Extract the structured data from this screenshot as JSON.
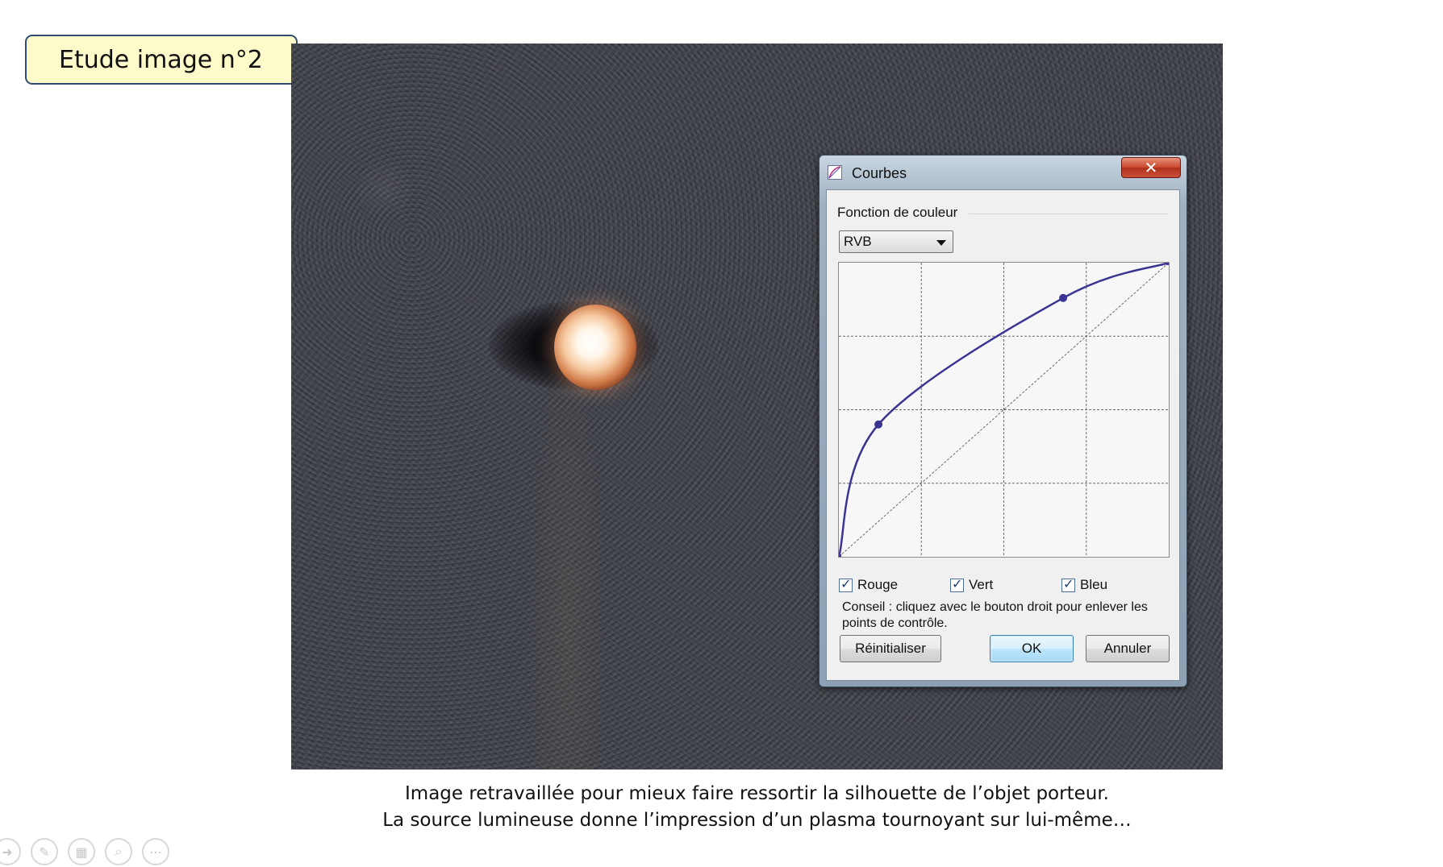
{
  "slide": {
    "title": "Etude image n°2",
    "caption_line1": "Image retravaillée pour mieux faire ressortir la silhouette de l’objet porteur.",
    "caption_line2": "La source lumineuse donne l’impression d’un plasma tournoyant sur lui-même…"
  },
  "dialog": {
    "title": "Courbes",
    "close_label": "✕",
    "group_label": "Fonction de couleur",
    "channel_select": {
      "value": "RVB",
      "options": [
        "RVB"
      ]
    },
    "channels": [
      {
        "label": "Rouge",
        "checked": true
      },
      {
        "label": "Vert",
        "checked": true
      },
      {
        "label": "Bleu",
        "checked": true
      }
    ],
    "hint": "Conseil : cliquez avec le bouton droit pour enlever les points de contrôle.",
    "buttons": {
      "reset": "Réinitialiser",
      "ok": "OK",
      "cancel": "Annuler"
    },
    "curve": {
      "grid_divisions": 4,
      "control_points": [
        [
          0,
          0
        ],
        [
          0.12,
          0.45
        ],
        [
          0.68,
          0.88
        ],
        [
          1,
          1
        ]
      ],
      "curve_color": "#3a3592"
    }
  },
  "toolbar": {
    "icons": [
      "arrow-icon",
      "pen-icon",
      "slides-icon",
      "zoom-icon",
      "more-icon"
    ]
  },
  "colors": {
    "title_bg": "#fdfbc9",
    "title_border": "#2f4d72",
    "photo_bg": "#404249"
  }
}
